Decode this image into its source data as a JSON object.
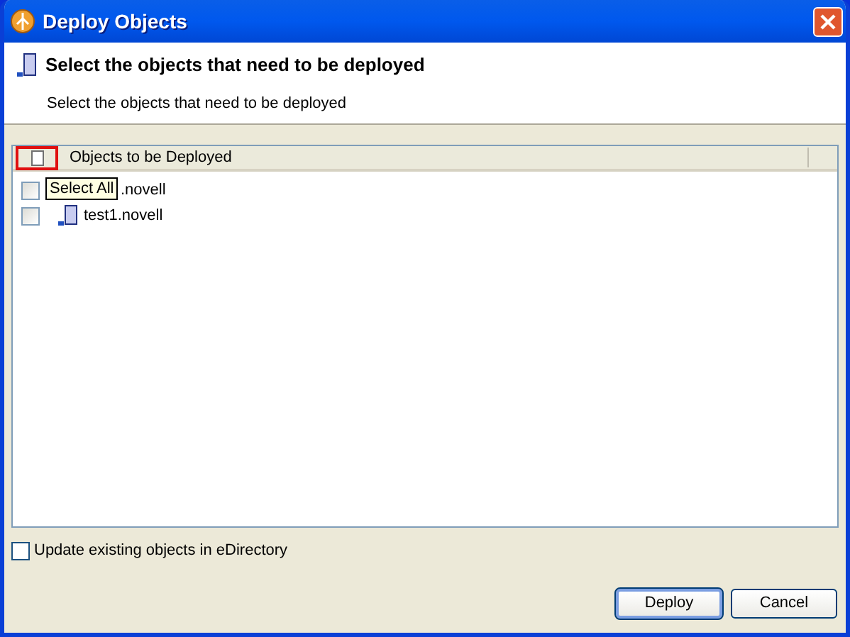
{
  "window": {
    "title": "Deploy Objects"
  },
  "header": {
    "title": "Select the objects that need to be deployed",
    "description": "Select the objects that need to be deployed"
  },
  "tree": {
    "column": "Objects to be Deployed",
    "select_all_checked": false,
    "tooltip": "Select All",
    "items": [
      {
        "label": ".novell",
        "checked": false
      },
      {
        "label": "test1.novell",
        "checked": false
      }
    ]
  },
  "update_option": {
    "label": "Update existing objects in eDirectory",
    "checked": false
  },
  "buttons": [
    {
      "label": "Deploy",
      "default": true
    },
    {
      "label": "Cancel",
      "default": false
    }
  ]
}
